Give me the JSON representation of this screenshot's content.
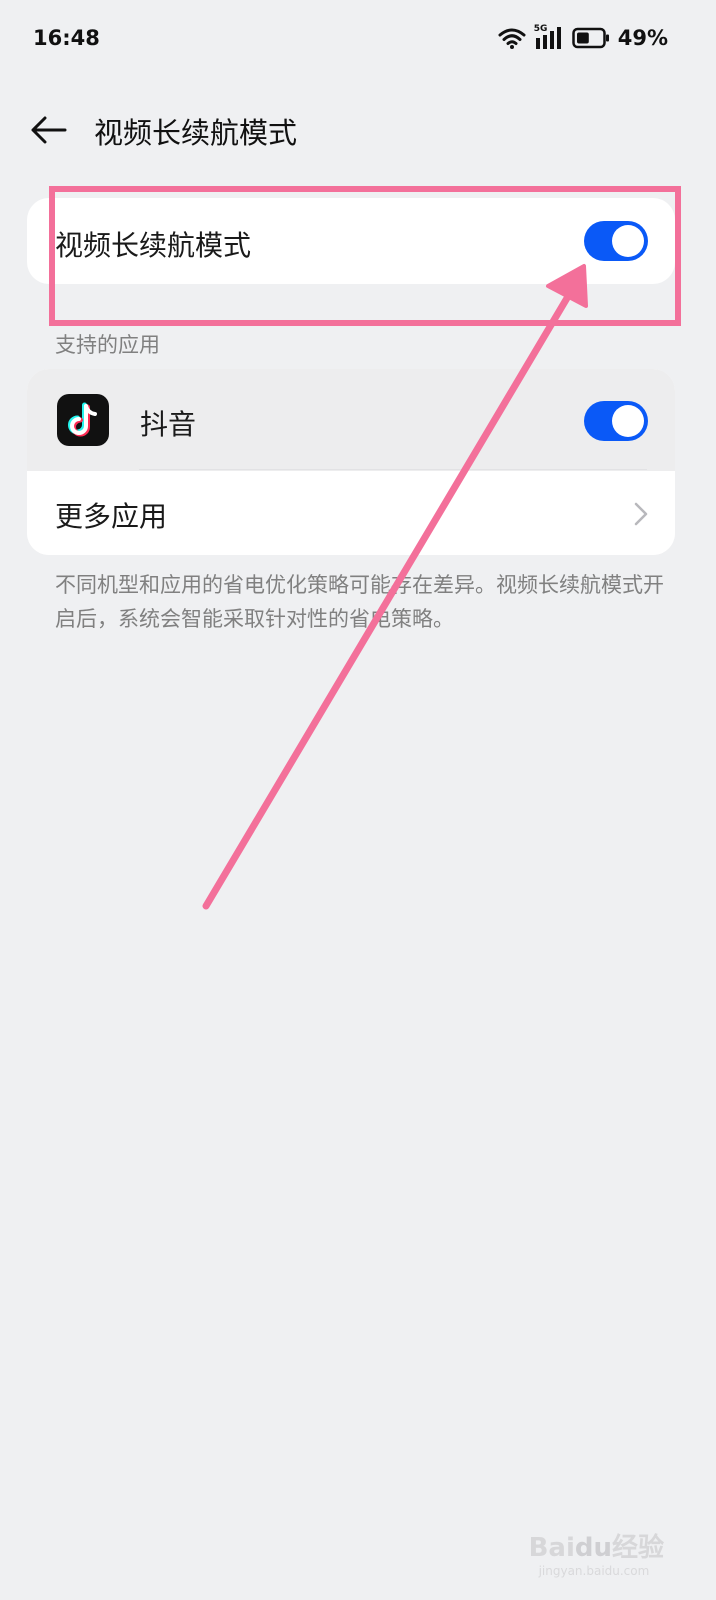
{
  "status_bar": {
    "time": "16:48",
    "network": "5G",
    "battery_percent": "49%",
    "battery_level": 0.49
  },
  "header": {
    "back_icon": "arrow-left-icon",
    "title": "视频长续航模式"
  },
  "main_toggle": {
    "label": "视频长续航模式",
    "enabled": true
  },
  "supported_apps": {
    "section_label": "支持的应用",
    "apps": [
      {
        "name": "抖音",
        "icon": "tiktok-icon",
        "enabled": true
      }
    ],
    "more_label": "更多应用"
  },
  "footer_note": "不同机型和应用的省电优化策略可能存在差异。视频长续航模式开启后，系统会智能采取针对性的省电策略。",
  "colors": {
    "toggle_on": "#0a59f7",
    "annotation": "#f3709a",
    "background": "#eff0f2"
  },
  "watermark": {
    "brand": "Baidu经验",
    "url": "jingyan.baidu.com"
  }
}
